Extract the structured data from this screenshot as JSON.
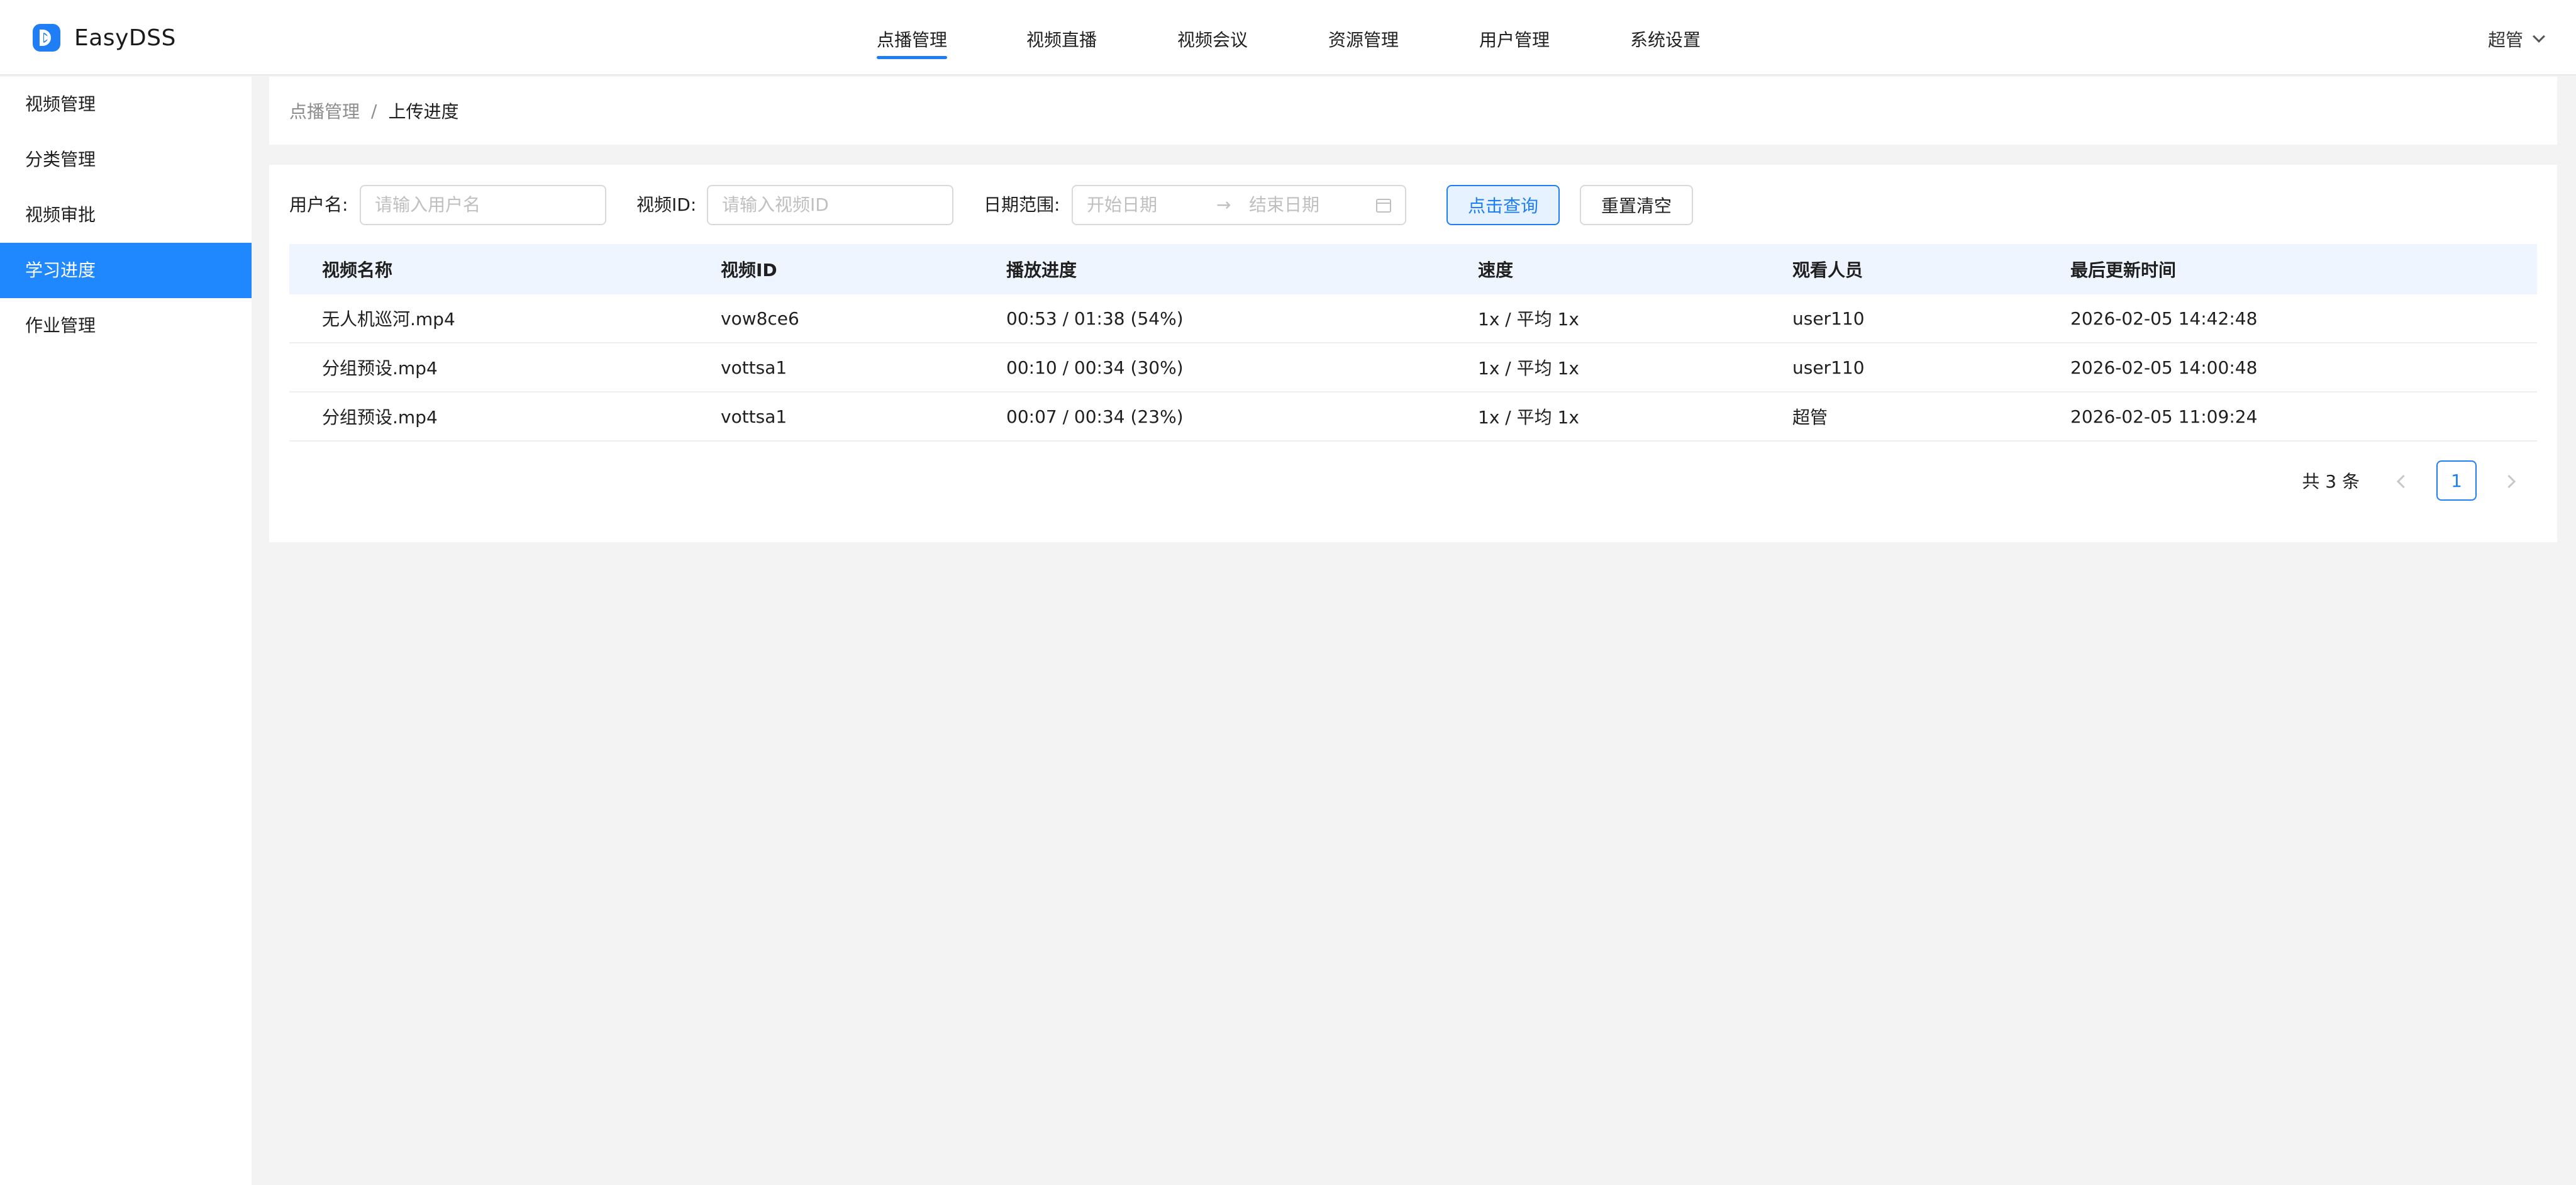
{
  "app": {
    "name": "EasyDSS",
    "logo_icon": "play-logo-icon",
    "accent_color": "#1f7ef5"
  },
  "topnav": {
    "items": [
      {
        "label": "点播管理",
        "active": true
      },
      {
        "label": "视频直播",
        "active": false
      },
      {
        "label": "视频会议",
        "active": false
      },
      {
        "label": "资源管理",
        "active": false
      },
      {
        "label": "用户管理",
        "active": false
      },
      {
        "label": "系统设置",
        "active": false
      }
    ]
  },
  "user": {
    "name": "超管",
    "icon": "chevron-down-icon"
  },
  "sidebar": {
    "items": [
      {
        "label": "视频管理",
        "active": false
      },
      {
        "label": "分类管理",
        "active": false
      },
      {
        "label": "视频审批",
        "active": false
      },
      {
        "label": "学习进度",
        "active": true
      },
      {
        "label": "作业管理",
        "active": false
      }
    ]
  },
  "breadcrumb": {
    "parent": "点播管理",
    "separator": "/",
    "current": "上传进度"
  },
  "filters": {
    "username_label": "用户名:",
    "username_placeholder": "请输入用户名",
    "videoid_label": "视频ID:",
    "videoid_placeholder": "请输入视频ID",
    "date_label": "日期范围:",
    "date_start_placeholder": "开始日期",
    "date_arrow": "→",
    "date_end_placeholder": "结束日期",
    "search_button": "点击查询",
    "reset_button": "重置清空"
  },
  "table": {
    "headers": [
      "视频名称",
      "视频ID",
      "播放进度",
      "速度",
      "观看人员",
      "最后更新时间"
    ],
    "rows": [
      [
        "无人机巡河.mp4",
        "vow8ce6",
        "00:53 / 01:38 (54%)",
        "1x / 平均 1x",
        "user110",
        "2026-02-05 14:42:48"
      ],
      [
        "分组预设.mp4",
        "vottsa1",
        "00:10 / 00:34 (30%)",
        "1x / 平均 1x",
        "user110",
        "2026-02-05 14:00:48"
      ],
      [
        "分组预设.mp4",
        "vottsa1",
        "00:07 / 00:34 (23%)",
        "1x / 平均 1x",
        "超管",
        "2026-02-05 11:09:24"
      ]
    ]
  },
  "pagination": {
    "total": "共 3 条",
    "current_page": "1"
  }
}
